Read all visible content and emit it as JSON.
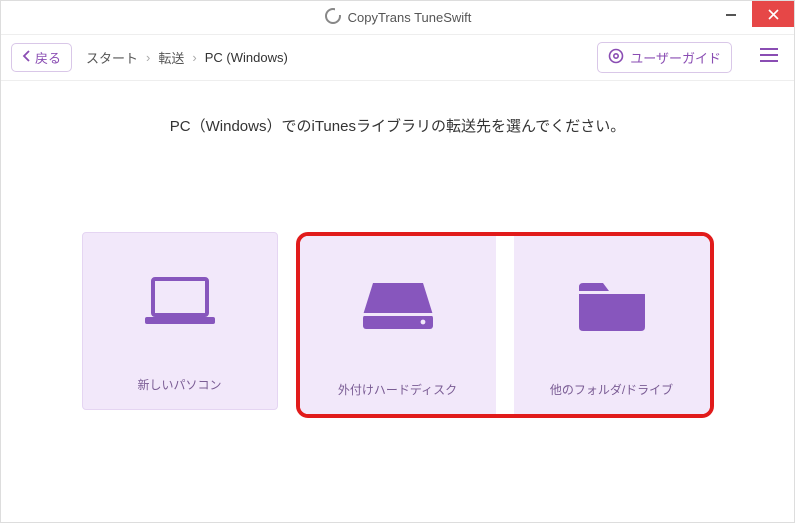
{
  "app": {
    "title": "CopyTrans TuneSwift"
  },
  "toolbar": {
    "back_label": "戻る",
    "guide_label": "ユーザーガイド"
  },
  "breadcrumb": {
    "items": [
      "スタート",
      "転送",
      "PC (Windows)"
    ]
  },
  "heading": "PC（Windows）でのiTunesライブラリの転送先を選んでください。",
  "cards": {
    "new_pc": {
      "label": "新しいパソコン"
    },
    "external_hdd": {
      "label": "外付けハードディスク"
    },
    "other_folder": {
      "label": "他のフォルダ/ドライブ"
    }
  },
  "colors": {
    "accent": "#8a4db3",
    "highlight": "#e11b1b",
    "card_bg": "#f2e8fa"
  }
}
